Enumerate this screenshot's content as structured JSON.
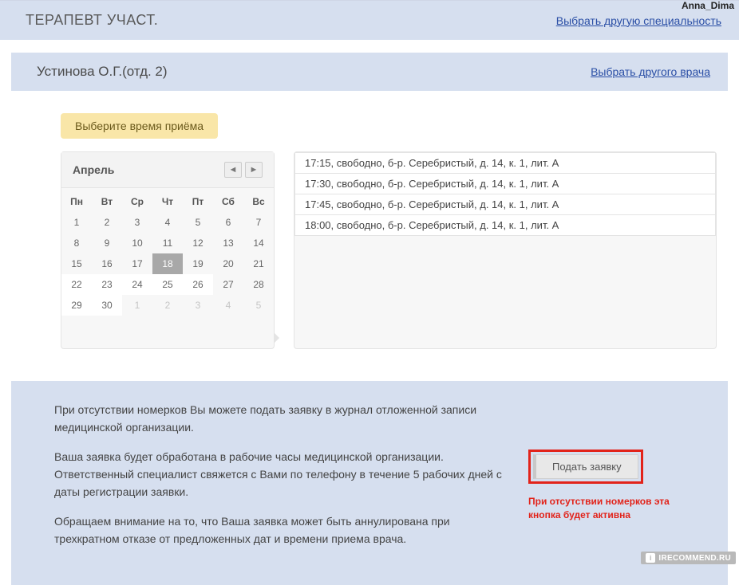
{
  "username": "Anna_Dima",
  "specialty": {
    "title": "ТЕРАПЕВТ УЧАСТ.",
    "change_link": "Выбрать другую специальность"
  },
  "doctor": {
    "name": "Устинова О.Г.(отд. 2)",
    "change_link": "Выбрать другого врача"
  },
  "pick_time_label": "Выберите время приёма",
  "calendar": {
    "month": "Апрель",
    "weekdays": [
      "Пн",
      "Вт",
      "Ср",
      "Чт",
      "Пт",
      "Сб",
      "Вс"
    ],
    "rows": [
      [
        {
          "d": "1"
        },
        {
          "d": "2"
        },
        {
          "d": "3"
        },
        {
          "d": "4"
        },
        {
          "d": "5"
        },
        {
          "d": "6"
        },
        {
          "d": "7"
        }
      ],
      [
        {
          "d": "8"
        },
        {
          "d": "9"
        },
        {
          "d": "10"
        },
        {
          "d": "11"
        },
        {
          "d": "12"
        },
        {
          "d": "13"
        },
        {
          "d": "14"
        }
      ],
      [
        {
          "d": "15"
        },
        {
          "d": "16"
        },
        {
          "d": "17"
        },
        {
          "d": "18",
          "selected": true
        },
        {
          "d": "19"
        },
        {
          "d": "20"
        },
        {
          "d": "21"
        }
      ],
      [
        {
          "d": "22",
          "white": true
        },
        {
          "d": "23",
          "white": true
        },
        {
          "d": "24",
          "white": true
        },
        {
          "d": "25",
          "white": true
        },
        {
          "d": "26",
          "white": true
        },
        {
          "d": "27"
        },
        {
          "d": "28"
        }
      ],
      [
        {
          "d": "29",
          "white": true
        },
        {
          "d": "30",
          "white": true
        },
        {
          "d": "1",
          "other": true
        },
        {
          "d": "2",
          "other": true
        },
        {
          "d": "3",
          "other": true
        },
        {
          "d": "4",
          "other": true
        },
        {
          "d": "5",
          "other": true
        }
      ]
    ]
  },
  "slots": [
    "17:15, свободно, б-р. Серебристый, д. 14, к. 1, лит. А",
    "17:30, свободно, б-р. Серебристый, д. 14, к. 1, лит. А",
    "17:45, свободно, б-р. Серебристый, д. 14, к. 1, лит. А",
    "18:00, свободно, б-р. Серебристый, д. 14, к. 1, лит. А"
  ],
  "application": {
    "p1": "При отсутствии номерков Вы можете подать заявку в журнал отложенной записи медицинской организации.",
    "p2": "Ваша заявка будет обработана в рабочие часы медицинской организации. Ответственный специалист свяжется с Вами по телефону в течение 5 рабочих дней с даты регистрации заявки.",
    "p3": "Обращаем внимание на то, что Ваша заявка может быть аннулирована при трехкратном отказе от предложенных дат и времени приема врача.",
    "submit_label": "Подать заявку",
    "red_note": "При отсутствии номерков эта кнопка будет активна"
  },
  "watermark": "IRECOMMEND.RU"
}
